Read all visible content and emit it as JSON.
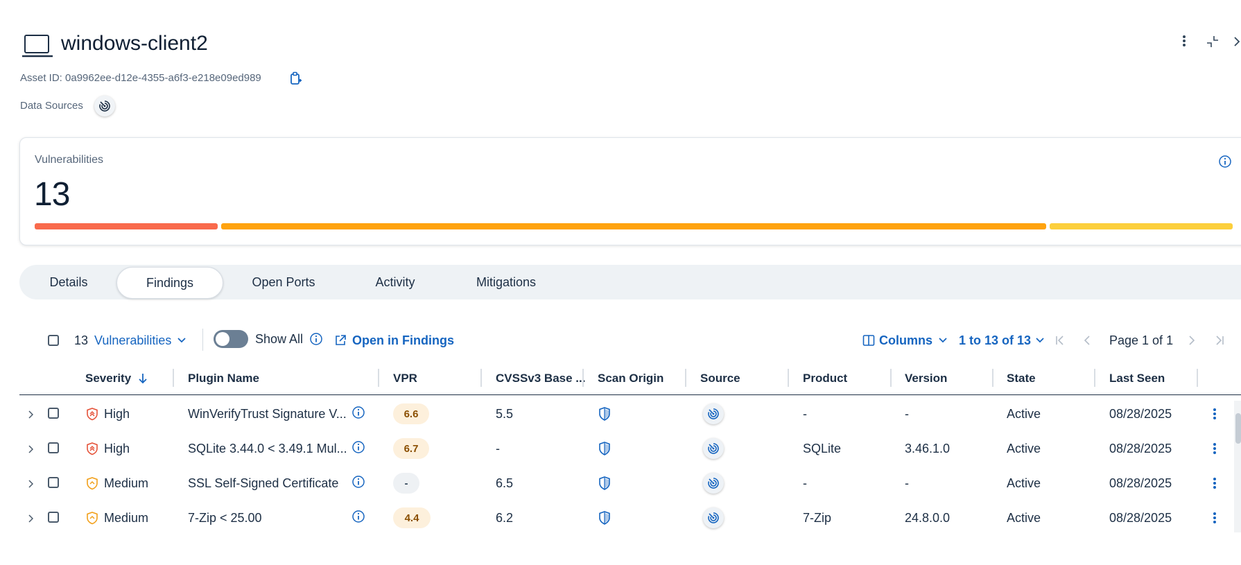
{
  "header": {
    "title": "windows-client2",
    "asset_id": "Asset ID: 0a9962ee-d12e-4355-a6f3-e218e09ed989",
    "data_sources_label": "Data Sources"
  },
  "vuln_card": {
    "label": "Vulnerabilities",
    "count": "13",
    "bar_colors": {
      "critical": "#f96a4c",
      "high": "#ffa30f",
      "medium": "#fccf3c"
    }
  },
  "tabs": [
    {
      "label": "Details"
    },
    {
      "label": "Findings",
      "active": true
    },
    {
      "label": "Open Ports"
    },
    {
      "label": "Activity"
    },
    {
      "label": "Mitigations"
    }
  ],
  "toolbar": {
    "count": "13",
    "type_label": "Vulnerabilities",
    "show_all_label": "Show All",
    "open_findings_label": "Open in Findings",
    "columns_label": "Columns",
    "range_label": "1 to 13 of 13",
    "page_label": "Page 1 of 1"
  },
  "table": {
    "headers": [
      "Severity",
      "Plugin Name",
      "VPR",
      "CVSSv3 Base ...",
      "Scan Origin",
      "Source",
      "Product",
      "Version",
      "State",
      "Last Seen"
    ],
    "rows": [
      {
        "severity": "High",
        "plugin": "WinVerifyTrust Signature V...",
        "vpr": "6.6",
        "cvss": "5.5",
        "product": "-",
        "version": "-",
        "state": "Active",
        "last_seen": "08/28/2025"
      },
      {
        "severity": "High",
        "plugin": "SQLite 3.44.0 < 3.49.1 Mul...",
        "vpr": "6.7",
        "cvss": "-",
        "product": "SQLite",
        "version": "3.46.1.0",
        "state": "Active",
        "last_seen": "08/28/2025"
      },
      {
        "severity": "Medium",
        "plugin": "SSL Self-Signed Certificate",
        "vpr": "-",
        "cvss": "6.5",
        "product": "-",
        "version": "-",
        "state": "Active",
        "last_seen": "08/28/2025"
      },
      {
        "severity": "Medium",
        "plugin": "7-Zip < 25.00",
        "vpr": "4.4",
        "cvss": "6.2",
        "product": "7-Zip",
        "version": "24.8.0.0",
        "state": "Active",
        "last_seen": "08/28/2025"
      }
    ]
  },
  "colors": {
    "high": "#e5533a",
    "medium": "#f2a01a",
    "vpr_bg": "#fdf0dc",
    "vpr_text": "#8a4e00",
    "vpr_empty_bg": "#eef1f4",
    "accent": "#1665c0"
  }
}
